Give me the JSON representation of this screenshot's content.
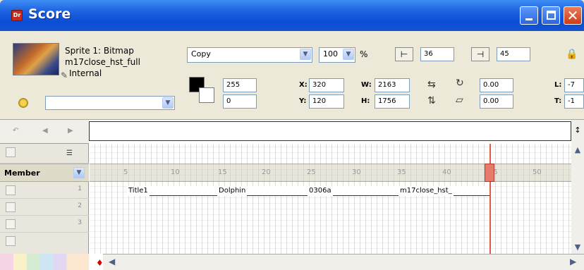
{
  "window": {
    "title": "Score",
    "app_icon_text": "Dr"
  },
  "sprite_info": {
    "line1": "Sprite 1: Bitmap",
    "line2": "m17close_hst_full",
    "line3": "Internal",
    "cast_select_value": ""
  },
  "properties": {
    "ink": "Copy",
    "blend": "100",
    "blend_unit": "%",
    "start_frame": "36",
    "end_frame": "45",
    "foreground": "255",
    "background": "0",
    "x_label": "X:",
    "x": "320",
    "y_label": "Y:",
    "y": "120",
    "w_label": "W:",
    "w": "2163",
    "h_label": "H:",
    "h": "1756",
    "rotation": "0.00",
    "skew": "0.00",
    "l_label": "L:",
    "l_value": "-7",
    "t_label": "T:",
    "t_value": "-1"
  },
  "score": {
    "channel_label": "Member",
    "channel_numbers": [
      "1",
      "2",
      "3"
    ],
    "frame_ticks": [
      "5",
      "10",
      "15",
      "20",
      "25",
      "30",
      "35",
      "40",
      "45",
      "50"
    ],
    "sprites": [
      {
        "name": "Title1"
      },
      {
        "name": "Dolphin"
      },
      {
        "name": "0306a"
      },
      {
        "name": "m17close_hst_"
      }
    ]
  },
  "colors": {
    "titlebar": "#0a4ed6",
    "playhead": "#e25a4a",
    "close_button": "#cf3b16"
  },
  "icons": [
    "app-icon",
    "minimize-icon",
    "maximize-icon",
    "close-icon",
    "gear-icon",
    "pen-icon",
    "rewind-icon",
    "play-icon",
    "marker-icon",
    "script-icon"
  ]
}
